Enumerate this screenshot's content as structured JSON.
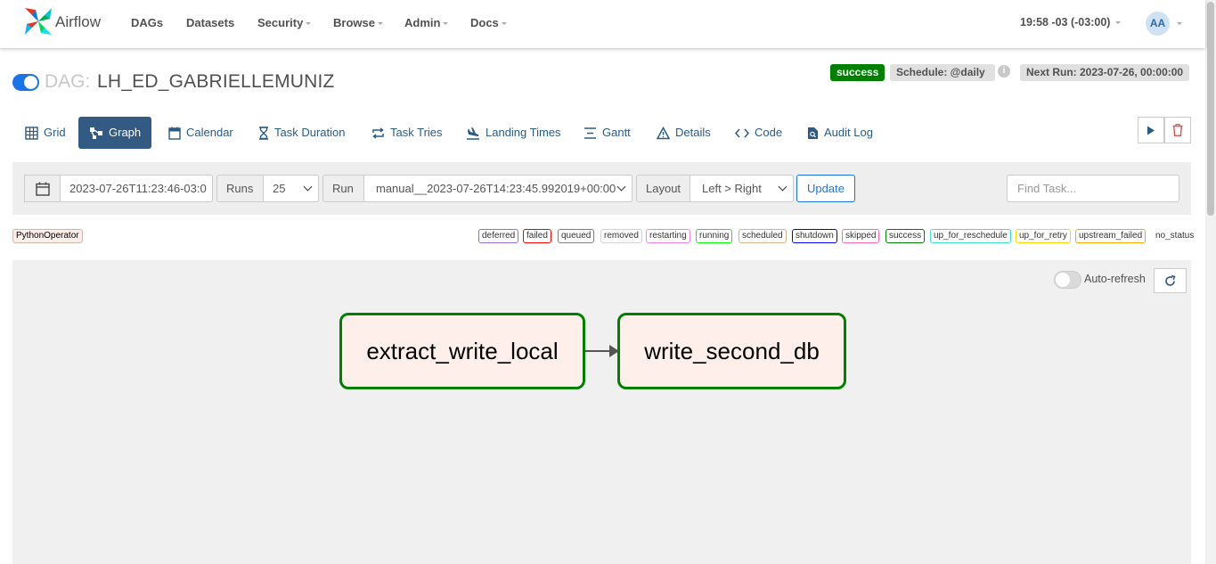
{
  "navbar": {
    "brand": "Airflow",
    "items": [
      "DAGs",
      "Datasets",
      "Security",
      "Browse",
      "Admin",
      "Docs"
    ],
    "clock": "19:58 -03 (-03:00)",
    "avatar": "AA"
  },
  "dag": {
    "prefix": "DAG:",
    "name": "LH_ED_GABRIELLEMUNIZ",
    "status": "success",
    "schedule": "Schedule: @daily",
    "info_icon": "i",
    "next_run": "Next Run: 2023-07-26, 00:00:00",
    "paused": false
  },
  "tabs": [
    {
      "label": "Grid",
      "icon": "grid-icon"
    },
    {
      "label": "Graph",
      "icon": "graph-icon"
    },
    {
      "label": "Calendar",
      "icon": "calendar-icon"
    },
    {
      "label": "Task Duration",
      "icon": "hourglass-icon"
    },
    {
      "label": "Task Tries",
      "icon": "repeat-icon"
    },
    {
      "label": "Landing Times",
      "icon": "landing-icon"
    },
    {
      "label": "Gantt",
      "icon": "gantt-icon"
    },
    {
      "label": "Details",
      "icon": "warning-triangle-icon"
    },
    {
      "label": "Code",
      "icon": "code-icon"
    },
    {
      "label": "Audit Log",
      "icon": "document-icon"
    }
  ],
  "active_tab": "Graph",
  "filter": {
    "date": "2023-07-26T11:23:46-03:0",
    "runs_label": "Runs",
    "runs_value": "25",
    "run_label": "Run",
    "run_value": "manual__2023-07-26T14:23:45.992019+00:00",
    "layout_label": "Layout",
    "layout_value": "Left > Right",
    "update": "Update",
    "find_placeholder": "Find Task..."
  },
  "operator": "PythonOperator",
  "legend": [
    {
      "label": "deferred",
      "color": "#9370db"
    },
    {
      "label": "failed",
      "color": "#ff0000"
    },
    {
      "label": "queued",
      "color": "#808080"
    },
    {
      "label": "removed",
      "color": "#d3d3d3"
    },
    {
      "label": "restarting",
      "color": "#ee82ee"
    },
    {
      "label": "running",
      "color": "#00ff00"
    },
    {
      "label": "scheduled",
      "color": "#d2b48c"
    },
    {
      "label": "shutdown",
      "color": "#0000ff"
    },
    {
      "label": "skipped",
      "color": "#ff69b4"
    },
    {
      "label": "success",
      "color": "#008000"
    },
    {
      "label": "up_for_reschedule",
      "color": "#40e0d0"
    },
    {
      "label": "up_for_retry",
      "color": "#ffd700"
    },
    {
      "label": "upstream_failed",
      "color": "#ffa500"
    },
    {
      "label": "no_status",
      "color": "transparent"
    }
  ],
  "graph": {
    "auto_refresh": "Auto-refresh",
    "nodes": [
      "extract_write_local",
      "write_second_db"
    ]
  }
}
